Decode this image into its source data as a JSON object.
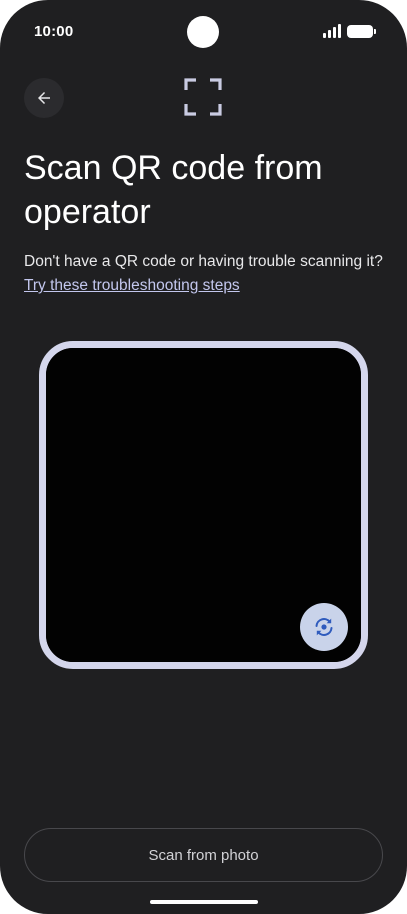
{
  "status_bar": {
    "time": "10:00",
    "icons": [
      "signal-icon",
      "battery-icon"
    ]
  },
  "header": {
    "back_icon": "arrow-left-icon",
    "scan_icon": "qr-frame-icon"
  },
  "title": "Scan QR code from operator",
  "help": {
    "text": "Don't have a QR code or having trouble scanning it?",
    "link": "Try these troubleshooting steps"
  },
  "scanner": {
    "switch_camera_icon": "switch-camera-icon"
  },
  "actions": {
    "scan_from_photo": "Scan from photo"
  },
  "colors": {
    "background": "#1f1f21",
    "frame": "#d4d6ec",
    "link": "#c3c7ee",
    "switch_button": "#c9d3ea",
    "switch_icon": "#2f5bbd"
  }
}
